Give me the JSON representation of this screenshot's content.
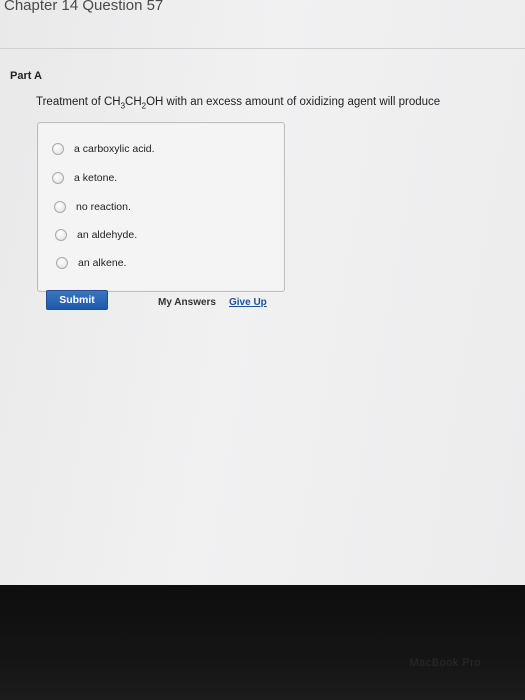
{
  "header": {
    "chapter_title": "Chapter 14 Question 57"
  },
  "part": {
    "label": "Part A"
  },
  "question": {
    "prefix": "Treatment of CH",
    "sub1": "3",
    "mid": "CH",
    "sub2": "2",
    "suffix": "OH with an excess amount of oxidizing agent will produce"
  },
  "options": [
    {
      "label": "a carboxylic acid."
    },
    {
      "label": "a ketone."
    },
    {
      "label": "no reaction."
    },
    {
      "label": "an aldehyde."
    },
    {
      "label": "an alkene."
    }
  ],
  "actions": {
    "submit_label": "Submit",
    "my_answers_label": "My Answers",
    "give_up_label": "Give Up"
  },
  "bezel": {
    "brand": "MacBook Pro"
  }
}
